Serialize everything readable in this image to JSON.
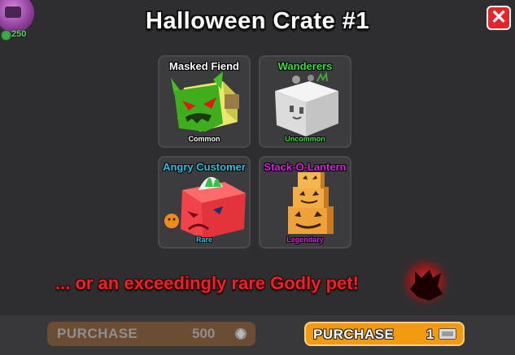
{
  "window": {
    "title": "Halloween Crate #1",
    "close_label": "✕"
  },
  "player": {
    "coin_amount": "250",
    "avatar_icon": "player-avatar-icon",
    "coin_icon": "coin-icon"
  },
  "pets": [
    {
      "name": "Masked Fiend",
      "rarity": "Common",
      "name_color": "#ffffff",
      "rarity_color": "#ffffff"
    },
    {
      "name": "Wanderers",
      "rarity": "Uncommon",
      "name_color": "#39e03a",
      "rarity_color": "#39e03a"
    },
    {
      "name": "Angry Customer",
      "rarity": "Rare",
      "name_color": "#22c7e6",
      "rarity_color": "#22c7e6"
    },
    {
      "name": "Stack-O-Lantern",
      "rarity": "Legendary",
      "name_color": "#d620e0",
      "rarity_color": "#d620e0"
    }
  ],
  "godly_text": "... or an exceedingly rare Godly pet!",
  "footer": {
    "purchase_gems": {
      "label": "PURCHASE",
      "price": "500",
      "icon": "gem-icon",
      "enabled": false
    },
    "purchase_tickets": {
      "label": "PURCHASE",
      "price": "1",
      "icon": "ticket-icon",
      "enabled": true
    }
  },
  "colors": {
    "accent_orange": "#f49a12",
    "close_red": "#e8222a",
    "godly_red": "#e3242b"
  }
}
